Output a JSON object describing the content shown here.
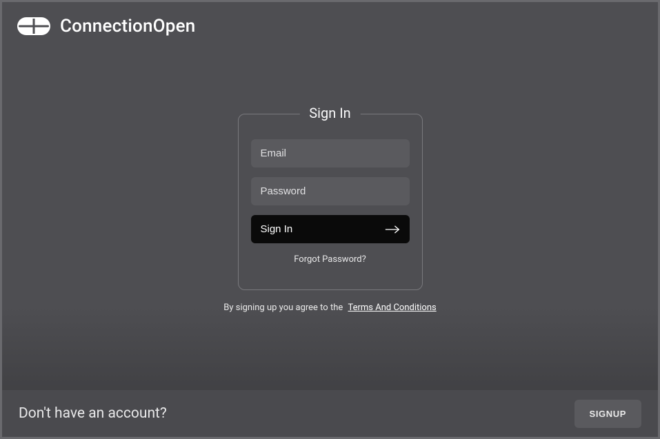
{
  "header": {
    "brand_name": "ConnectionOpen"
  },
  "signin": {
    "legend": "Sign In",
    "email_placeholder": "Email",
    "password_placeholder": "Password",
    "button_label": "Sign In",
    "forgot_label": "Forgot Password?"
  },
  "terms": {
    "prefix": "By signing up you agree to the",
    "link_label": "Terms And Conditions"
  },
  "footer": {
    "prompt": "Don't have an account?",
    "signup_label": "SIGNUP"
  }
}
